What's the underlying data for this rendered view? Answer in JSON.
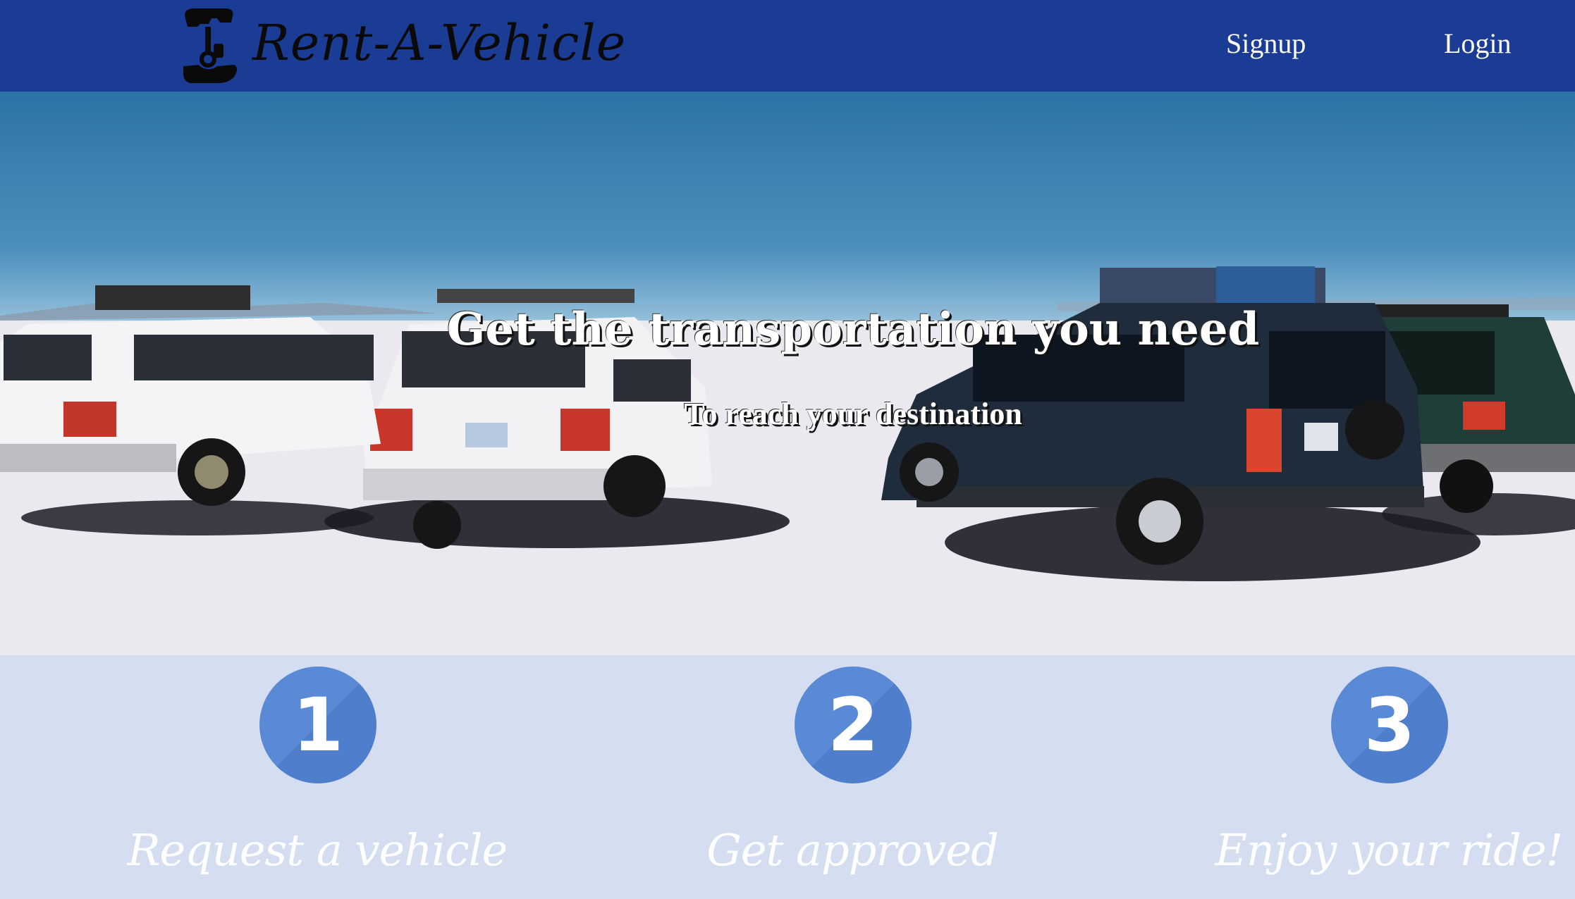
{
  "header": {
    "brand_name": "Rent-A-Vehicle",
    "logo_icon": "key-hand-icon",
    "background_color": "#1b3c95",
    "nav": [
      {
        "label": "Signup"
      },
      {
        "label": "Login"
      }
    ]
  },
  "hero": {
    "title": "Get the transportation you need",
    "subtitle": "To reach your destination"
  },
  "steps": [
    {
      "number": "1",
      "label": "Request a vehicle"
    },
    {
      "number": "2",
      "label": "Get approved"
    },
    {
      "number": "3",
      "label": "Enjoy your ride!"
    }
  ],
  "colors": {
    "badge": "#5a8ad6",
    "steps_background": "#d5def0"
  }
}
